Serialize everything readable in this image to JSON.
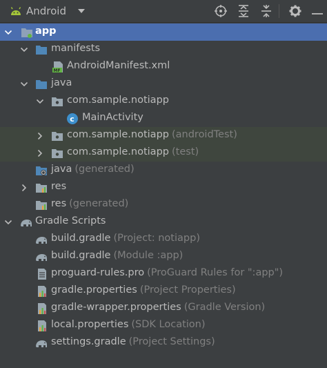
{
  "toolbar": {
    "title": "Android",
    "icons": [
      "android-icon",
      "dropdown-arrow",
      "locate-icon",
      "expand-all-icon",
      "collapse-all-icon",
      "gear-icon",
      "hide-icon"
    ]
  },
  "colors": {
    "background": "#3c3f41",
    "selected_row": "#4b6eaf",
    "test_row": "#3f463e",
    "folder_blue": "#4f87b8",
    "text": "#bbbbbb",
    "hint": "#808080"
  },
  "tree": {
    "app": "app",
    "manifests": "manifests",
    "android_manifest": "AndroidManifest.xml",
    "java": "java",
    "pkg_main": "com.sample.notiapp",
    "main_activity": "MainActivity",
    "pkg_android_test": "com.sample.notiapp",
    "pkg_android_test_hint": "(androidTest)",
    "pkg_test": "com.sample.notiapp",
    "pkg_test_hint": "(test)",
    "java_generated": "java",
    "java_generated_hint": "(generated)",
    "res": "res",
    "res_generated": "res",
    "res_generated_hint": "(generated)",
    "gradle_scripts": "Gradle Scripts",
    "build_gradle_project": "build.gradle",
    "build_gradle_project_hint": "(Project: notiapp)",
    "build_gradle_module": "build.gradle",
    "build_gradle_module_hint": "(Module :app)",
    "proguard": "proguard-rules.pro",
    "proguard_hint": "(ProGuard Rules for \":app\")",
    "gradle_properties": "gradle.properties",
    "gradle_properties_hint": "(Project Properties)",
    "gradle_wrapper": "gradle-wrapper.properties",
    "gradle_wrapper_hint": "(Gradle Version)",
    "local_properties": "local.properties",
    "local_properties_hint": "(SDK Location)",
    "settings_gradle": "settings.gradle",
    "settings_gradle_hint": "(Project Settings)"
  }
}
